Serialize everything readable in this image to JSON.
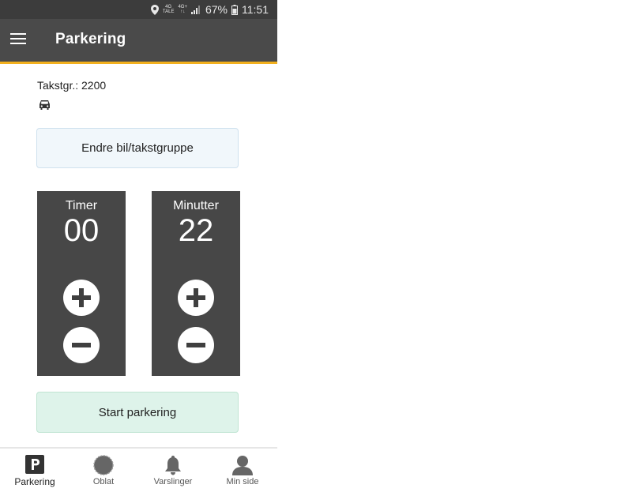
{
  "status_bar": {
    "net_top": "4G",
    "net_bottom": "TALE",
    "net2_top": "4G+",
    "net2_bottom": "↑↓",
    "battery": "67%",
    "time": "11:51"
  },
  "app_bar": {
    "title": "Parkering"
  },
  "vehicle": {
    "takst": "Takstgr.: 2200",
    "icon": "car-icon"
  },
  "change_button": {
    "label": "Endre bil/takstgruppe"
  },
  "timers": {
    "hours": {
      "label": "Timer",
      "value": "00"
    },
    "minutes": {
      "label": "Minutter",
      "value": "22"
    }
  },
  "start_button": {
    "label": "Start parkering"
  },
  "bottom_nav": {
    "items": [
      {
        "label": "Parkering",
        "icon": "parking-icon",
        "active": true
      },
      {
        "label": "Oblat",
        "icon": "oblat-icon"
      },
      {
        "label": "Varslinger",
        "icon": "bell-icon"
      },
      {
        "label": "Min side",
        "icon": "user-icon"
      }
    ]
  },
  "colors": {
    "appbar": "#4a4a4a",
    "accent": "#f2b01e",
    "panel": "#474747",
    "change_btn_bg": "#f1f7fb",
    "start_btn_bg": "#def3ea"
  }
}
